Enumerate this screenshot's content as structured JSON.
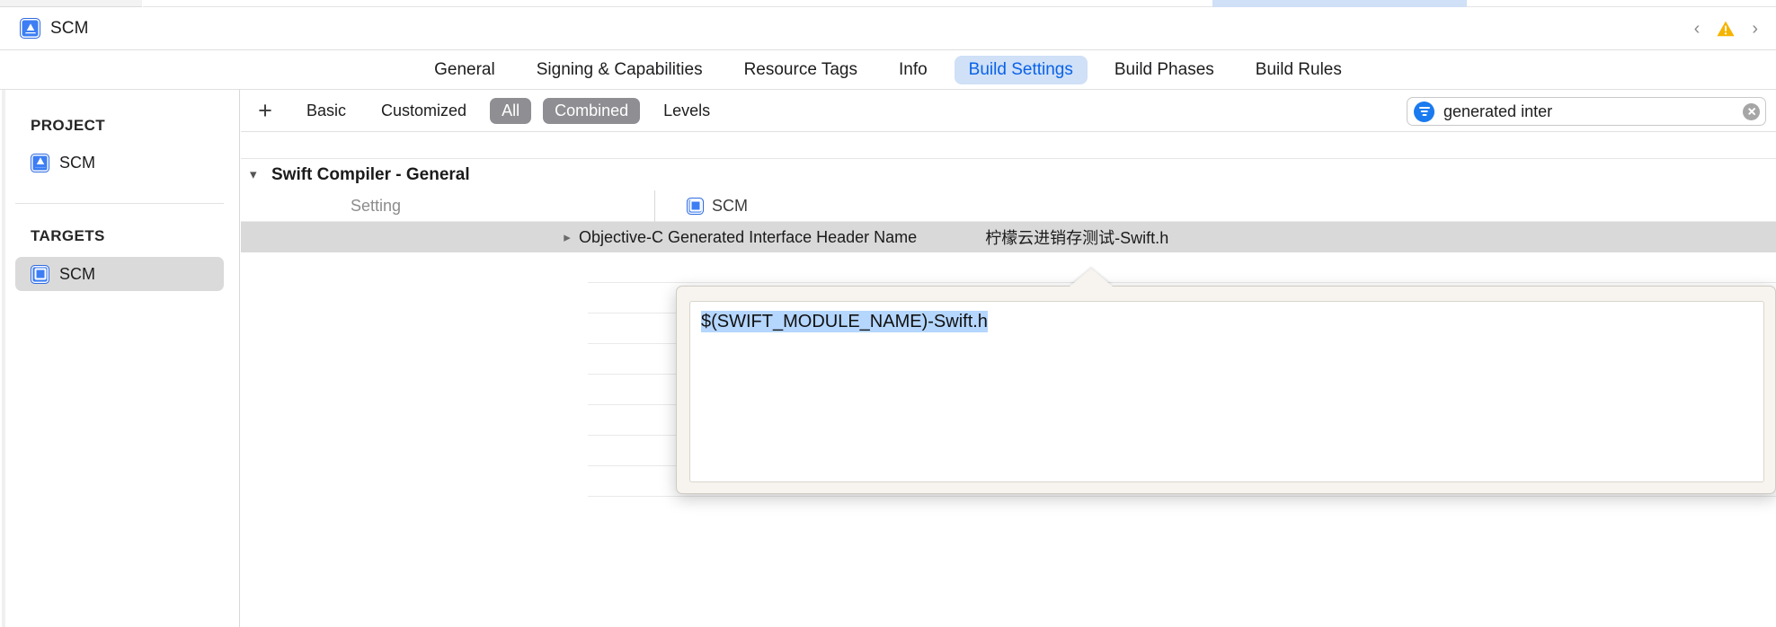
{
  "window": {
    "title": "SCM",
    "project_icon": "xcode-project-icon",
    "nav_back_icon": "chevron-left-icon",
    "nav_forward_icon": "chevron-right-icon",
    "warning_icon": "warning-triangle-icon"
  },
  "tabs": [
    {
      "label": "General",
      "selected": false
    },
    {
      "label": "Signing & Capabilities",
      "selected": false
    },
    {
      "label": "Resource Tags",
      "selected": false
    },
    {
      "label": "Info",
      "selected": false
    },
    {
      "label": "Build Settings",
      "selected": true
    },
    {
      "label": "Build Phases",
      "selected": false
    },
    {
      "label": "Build Rules",
      "selected": false
    }
  ],
  "sidebar": {
    "project_section_label": "PROJECT",
    "project_items": [
      {
        "label": "SCM",
        "icon": "xcode-project-icon",
        "selected": false
      }
    ],
    "targets_section_label": "TARGETS",
    "target_items": [
      {
        "label": "SCM",
        "icon": "xcode-target-icon",
        "selected": true
      }
    ]
  },
  "toolbar": {
    "add_label": "+",
    "filters": [
      {
        "label": "Basic",
        "active": false
      },
      {
        "label": "Customized",
        "active": false
      },
      {
        "label": "All",
        "active": true
      },
      {
        "label": "Combined",
        "active": true
      },
      {
        "label": "Levels",
        "active": false
      }
    ]
  },
  "search": {
    "value": "generated inter",
    "placeholder": "Search",
    "filter_icon": "filter-icon",
    "clear_icon": "clear-circle-icon"
  },
  "table": {
    "group_title": "Swift Compiler - General",
    "columns": {
      "setting": "Setting",
      "target": "SCM"
    },
    "rows": [
      {
        "name": "Objective-C Generated Interface Header Name",
        "value": "柠檬云进销存测试-Swift.h",
        "selected": true,
        "expandable": true
      }
    ]
  },
  "popover": {
    "value": "$(SWIFT_MODULE_NAME)-Swift.h",
    "selected": true
  },
  "colors": {
    "accent_blue": "#0a62e8",
    "tab_selected_bg": "#cfe0f7",
    "segment_active_bg": "#8e8e93",
    "row_selected_bg": "#d9d9d9",
    "text_selection_bg": "#b5d6fd",
    "filter_icon_blue": "#1a7aef",
    "warning_yellow": "#f5b400"
  }
}
